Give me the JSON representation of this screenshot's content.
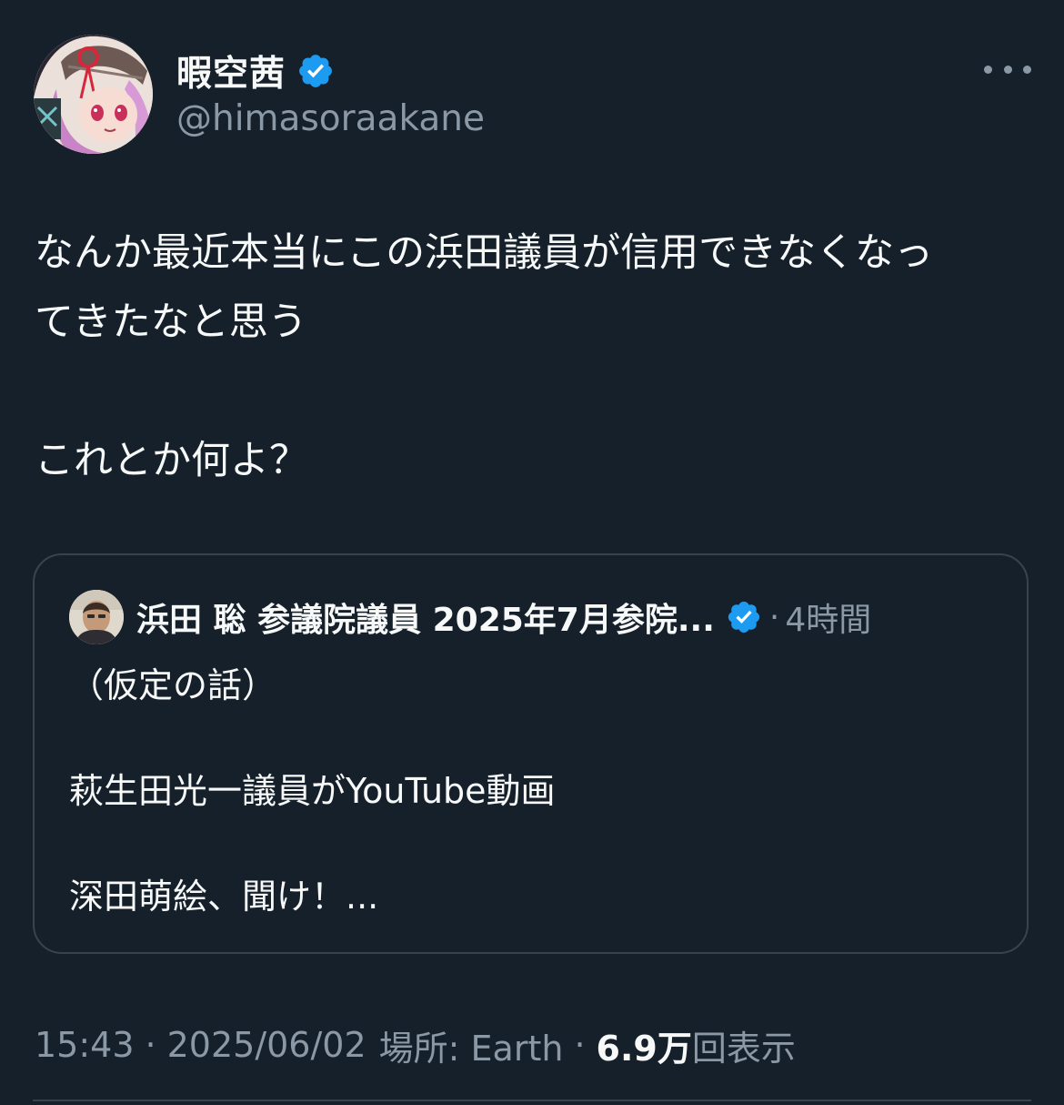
{
  "tweet": {
    "author": {
      "display_name": "暇空茜",
      "handle": "@himasoraakane",
      "verified": true
    },
    "text_lines": [
      "なんか最近本当にこの浜田議員が信用できなくなっ",
      "てきたなと思う",
      "",
      "これとか何よ？"
    ],
    "quote": {
      "author_name": "浜田 聡 参議院議員 2025年7月参院...",
      "verified": true,
      "separator": "·",
      "time": "4時間",
      "text_lines": [
        "（仮定の話）",
        "",
        "萩生田光一議員がYouTube動画",
        "",
        "深田萌絵、聞け！..."
      ]
    },
    "meta": {
      "time": "15:43",
      "separator": "·",
      "date": "2025/06/02",
      "location": "場所: Earth",
      "views_count": "6.9万",
      "views_label": "回表示"
    }
  },
  "icons": {
    "verified": "verified-badge-icon",
    "more": "more-options-icon"
  },
  "colors": {
    "background": "#15202b",
    "text_primary": "#f7f9f9",
    "text_secondary": "#8b98a5",
    "border": "#38444d",
    "verified_blue": "#1d9bf0"
  }
}
